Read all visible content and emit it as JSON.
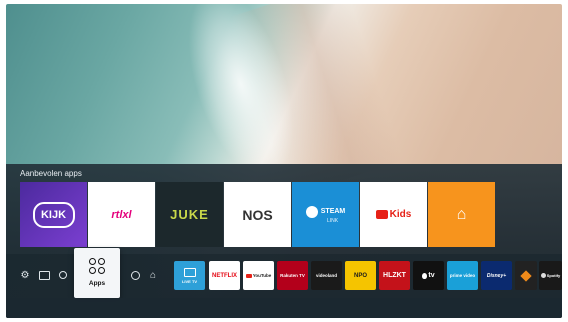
{
  "recommended": {
    "title": "Aanbevolen apps",
    "apps": [
      {
        "name": "KIJK",
        "label": "KIJK",
        "bg": "#5a2fa8"
      },
      {
        "name": "rtlxl",
        "label": "rtlxl",
        "bg": "#ffffff"
      },
      {
        "name": "JUKE",
        "label": "JUKE",
        "bg": "#1e2a2e"
      },
      {
        "name": "NOS",
        "label": "NOS",
        "bg": "#ffffff"
      },
      {
        "name": "Steam Link",
        "label": "STEAM",
        "sublabel": "LINK",
        "bg": "#1b8fd6"
      },
      {
        "name": "YouTube Kids",
        "label": "Kids",
        "bg": "#ffffff"
      },
      {
        "name": "Thuisbezorgd",
        "label": "⌂",
        "bg": "#f7941d"
      }
    ]
  },
  "bar": {
    "apps_label": "Apps",
    "left_icons": [
      "settings-icon",
      "source-icon",
      "search-icon"
    ],
    "right_icons": [
      "ambient-icon",
      "home-icon"
    ],
    "apps": [
      {
        "name": "live-tv",
        "label": "LIVE TV",
        "bg": "#2ea0d8",
        "fg": "#ffffff"
      },
      {
        "name": "netflix",
        "label": "NETFLIX",
        "bg": "#ffffff",
        "fg": "#e50914"
      },
      {
        "name": "youtube",
        "label": "YouTube",
        "bg": "#ffffff",
        "fg": "#222222"
      },
      {
        "name": "rakuten-tv",
        "label": "Rakuten TV",
        "bg": "#b3001b",
        "fg": "#ffffff"
      },
      {
        "name": "videoland",
        "label": "videoland",
        "bg": "#1a1a1a",
        "fg": "#ffffff"
      },
      {
        "name": "npo",
        "label": "NPO",
        "bg": "#f5c400",
        "fg": "#1a1a1a"
      },
      {
        "name": "hollandse",
        "label": "HLZKT",
        "bg": "#c4121a",
        "fg": "#ffffff"
      },
      {
        "name": "apple-tv",
        "label": "tv",
        "bg": "#111111",
        "fg": "#ffffff"
      },
      {
        "name": "prime-video",
        "label": "prime video",
        "bg": "#1aa0d8",
        "fg": "#ffffff"
      },
      {
        "name": "disney-plus",
        "label": "Disney+",
        "bg": "#0b2a6f",
        "fg": "#ffffff"
      },
      {
        "name": "generic-app",
        "label": "",
        "bg": "#222222",
        "fg": "#f08a1a"
      },
      {
        "name": "spotify",
        "label": "Spotify",
        "bg": "#191919",
        "fg": "#ffffff"
      }
    ]
  },
  "colors": {
    "panel": "#24323a",
    "focus": "#f4f6f8"
  }
}
